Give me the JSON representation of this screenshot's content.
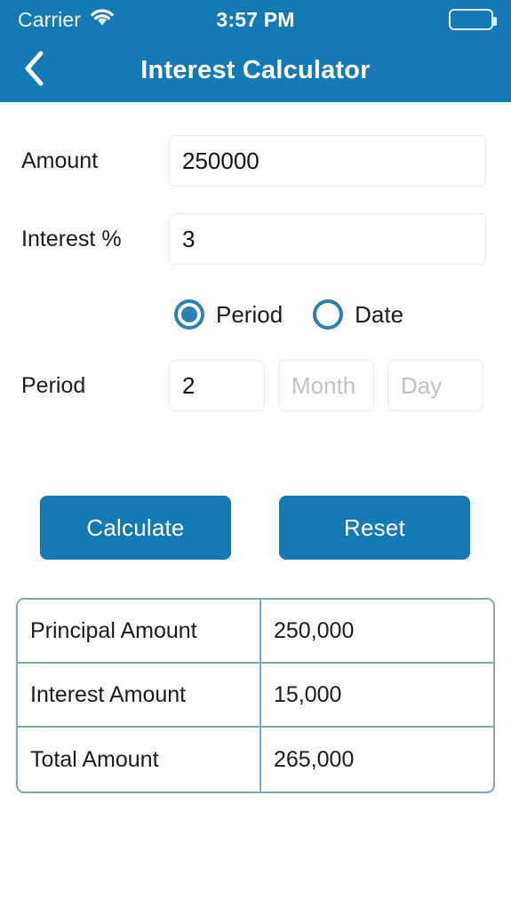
{
  "status_bar": {
    "carrier": "Carrier",
    "wifi_icon": "wifi-icon",
    "time": "3:57 PM",
    "battery_icon": "battery-full-icon"
  },
  "nav_bar": {
    "back_icon": "chevron-left-icon",
    "title": "Interest Calculator"
  },
  "form": {
    "amount": {
      "label": "Amount",
      "value": "250000",
      "placeholder": ""
    },
    "interest": {
      "label": "Interest %",
      "value": "3",
      "placeholder": ""
    },
    "mode_options": [
      {
        "label": "Period",
        "selected": true
      },
      {
        "label": "Date",
        "selected": false
      }
    ],
    "period": {
      "label": "Period",
      "year_value": "2",
      "year_placeholder": "",
      "month_value": "",
      "month_placeholder": "Month",
      "day_value": "",
      "day_placeholder": "Day"
    }
  },
  "buttons": {
    "calculate": "Calculate",
    "reset": "Reset"
  },
  "results": {
    "rows": [
      {
        "label": "Principal Amount",
        "value": "250,000"
      },
      {
        "label": "Interest Amount",
        "value": "15,000"
      },
      {
        "label": "Total Amount",
        "value": "265,000"
      }
    ]
  },
  "colors": {
    "header_blue": "#1579B4",
    "button_blue": "#1579B4",
    "radio_blue": "#2E7FB5",
    "table_border": "#7FA8BE",
    "input_border": "#ececec"
  }
}
